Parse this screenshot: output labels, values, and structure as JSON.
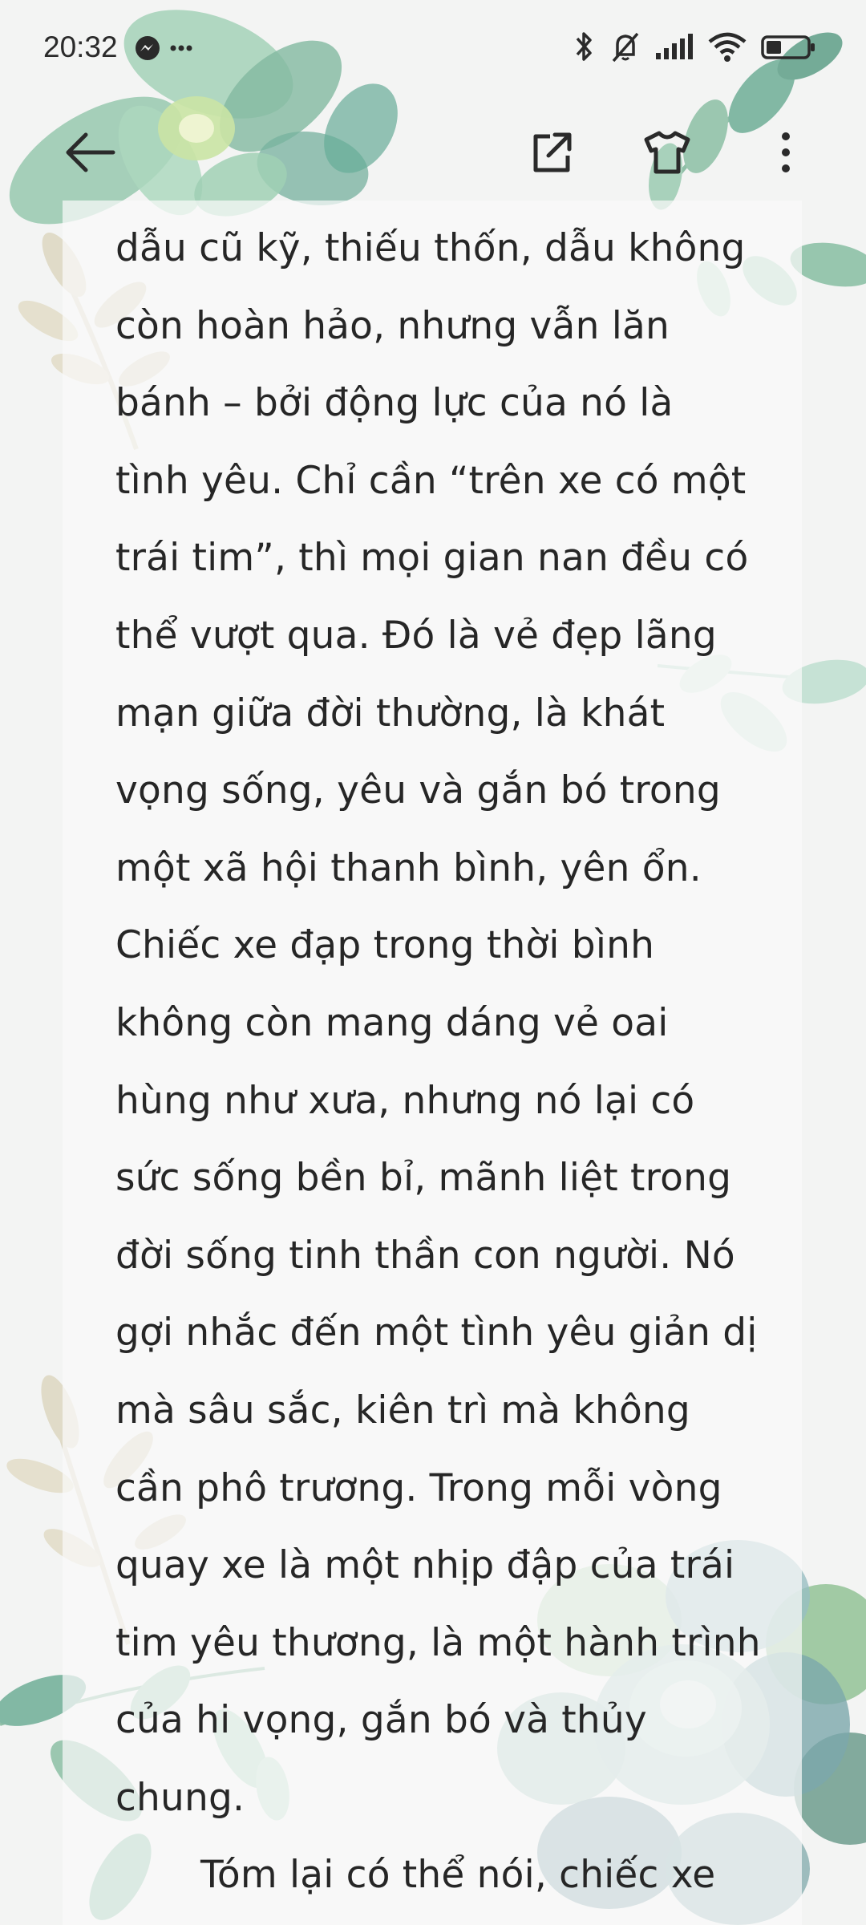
{
  "status_bar": {
    "time": "20:32",
    "left_icons": [
      "messenger-icon",
      "more-notifications-icon"
    ],
    "right_icons": [
      "bluetooth-icon",
      "muted-bell-icon",
      "signal-icon",
      "wifi-icon",
      "battery-icon"
    ]
  },
  "toolbar": {
    "icons": [
      "back-arrow-icon",
      "open-external-icon",
      "theme-shirt-icon",
      "more-vertical-icon"
    ]
  },
  "reader": {
    "lines": [
      "dẫu cũ kỹ, thiếu thốn, dẫu không",
      "còn hoàn hảo, nhưng vẫn lăn",
      "bánh – bởi động lực của nó là",
      "tình yêu. Chỉ cần “trên xe có một",
      "trái tim”, thì mọi gian nan đều có",
      "thể vượt qua. Đó là vẻ đẹp lãng",
      "mạn giữa đời thường, là khát",
      "vọng sống, yêu và gắn bó trong",
      "một xã hội thanh bình, yên ổn.",
      "Chiếc xe đạp trong thời bình",
      "không còn mang dáng vẻ oai",
      "hùng như xưa, nhưng nó lại có",
      "sức sống bền bỉ, mãnh liệt trong",
      "đời sống tinh thần con người. Nó",
      "gợi nhắc đến một tình yêu giản dị",
      "mà sâu sắc, kiên trì mà không",
      "cần phô trương. Trong mỗi vòng",
      "quay xe là một nhịp đập của trái",
      "tim yêu thương, là một hành trình",
      "của hi vọng, gắn bó và thủy",
      "chung."
    ],
    "next_paragraph": "Tóm lại có thể nói, chiếc xe"
  },
  "colors": {
    "background": "#f3f4f3",
    "text": "#262626",
    "leaf_green": "#7fb69a",
    "leaf_beige": "#d8d2bb",
    "succulent_blue": "#6f9fa4"
  }
}
